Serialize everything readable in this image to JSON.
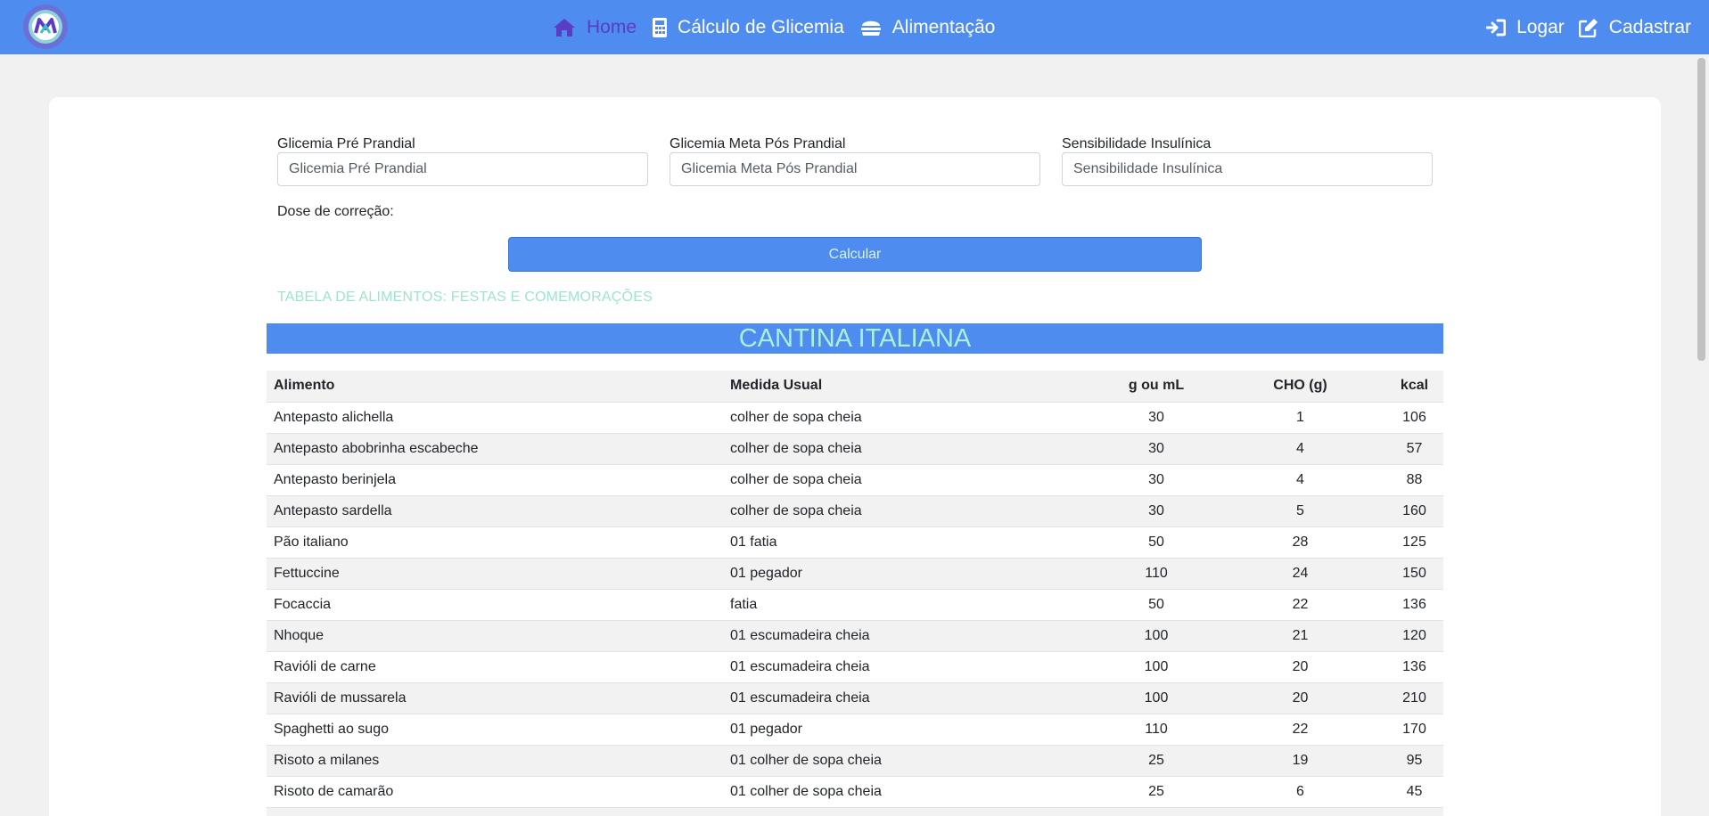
{
  "nav": {
    "home": "Home",
    "calculo": "Cálculo de Glicemia",
    "alimentacao": "Alimentação",
    "logar": "Logar",
    "cadastrar": "Cadastrar"
  },
  "form": {
    "pre_label": "Glicemia Pré Prandial",
    "pre_placeholder": "Glicemia Pré Prandial",
    "meta_label": "Glicemia Meta Pós Prandial",
    "meta_placeholder": "Glicemia Meta Pós Prandial",
    "sens_label": "Sensibilidade Insulínica",
    "sens_placeholder": "Sensibilidade Insulínica",
    "dose_label": "Dose de correção:",
    "calc_button": "Calcular"
  },
  "table": {
    "title": "TABELA DE ALIMENTOS: FESTAS E COMEMORAÇÕES",
    "banner": "CANTINA ITALIANA",
    "headers": [
      "Alimento",
      "Medida Usual",
      "g ou mL",
      "CHO (g)",
      "kcal"
    ],
    "rows": [
      [
        "Antepasto alichella",
        "colher de sopa cheia",
        "30",
        "1",
        "106"
      ],
      [
        "Antepasto abobrinha escabeche",
        "colher de sopa cheia",
        "30",
        "4",
        "57"
      ],
      [
        "Antepasto berinjela",
        "colher de sopa cheia",
        "30",
        "4",
        "88"
      ],
      [
        "Antepasto sardella",
        "colher de sopa cheia",
        "30",
        "5",
        "160"
      ],
      [
        "Pão italiano",
        "01 fatia",
        "50",
        "28",
        "125"
      ],
      [
        "Fettuccine",
        "01 pegador",
        "110",
        "24",
        "150"
      ],
      [
        "Focaccia",
        "fatia",
        "50",
        "22",
        "136"
      ],
      [
        "Nhoque",
        "01 escumadeira cheia",
        "100",
        "21",
        "120"
      ],
      [
        "Ravióli de carne",
        "01 escumadeira cheia",
        "100",
        "20",
        "136"
      ],
      [
        "Ravióli de mussarela",
        "01 escumadeira cheia",
        "100",
        "20",
        "210"
      ],
      [
        "Spaghetti ao sugo",
        "01 pegador",
        "110",
        "22",
        "170"
      ],
      [
        "Risoto a milanes",
        "01 colher de sopa cheia",
        "25",
        "19",
        "95"
      ],
      [
        "Risoto de camarão",
        "01 colher de sopa cheia",
        "25",
        "6",
        "45"
      ],
      [
        "",
        "",
        "",
        "",
        ""
      ]
    ]
  },
  "colors": {
    "navbar": "#4f8cf0",
    "active_link": "#5b3cc4",
    "banner_text": "#a9f0d7",
    "table_title": "#9fe3cf"
  }
}
